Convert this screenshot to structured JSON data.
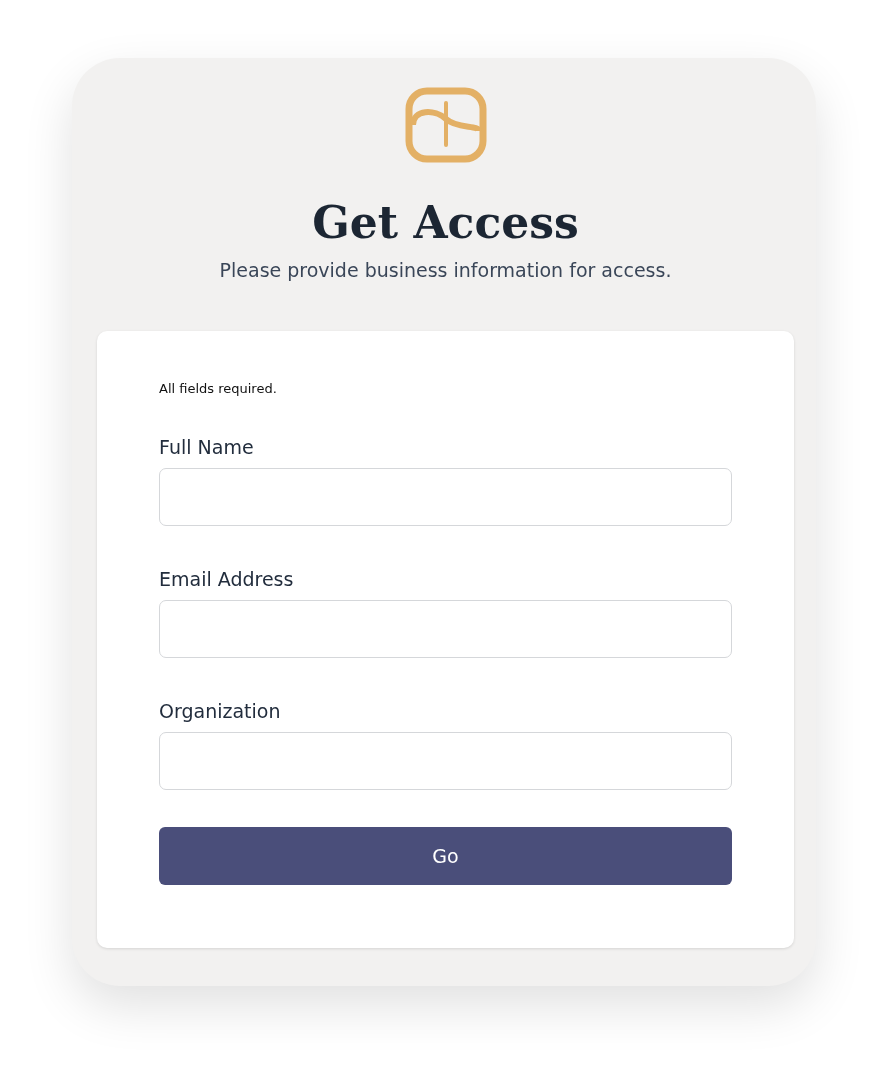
{
  "header": {
    "title": "Get Access",
    "subtitle": "Please provide business information for access."
  },
  "form": {
    "note": "All fields required.",
    "fields": [
      {
        "label": "Full Name"
      },
      {
        "label": "Email Address"
      },
      {
        "label": "Organization"
      }
    ],
    "submit": "Go"
  }
}
